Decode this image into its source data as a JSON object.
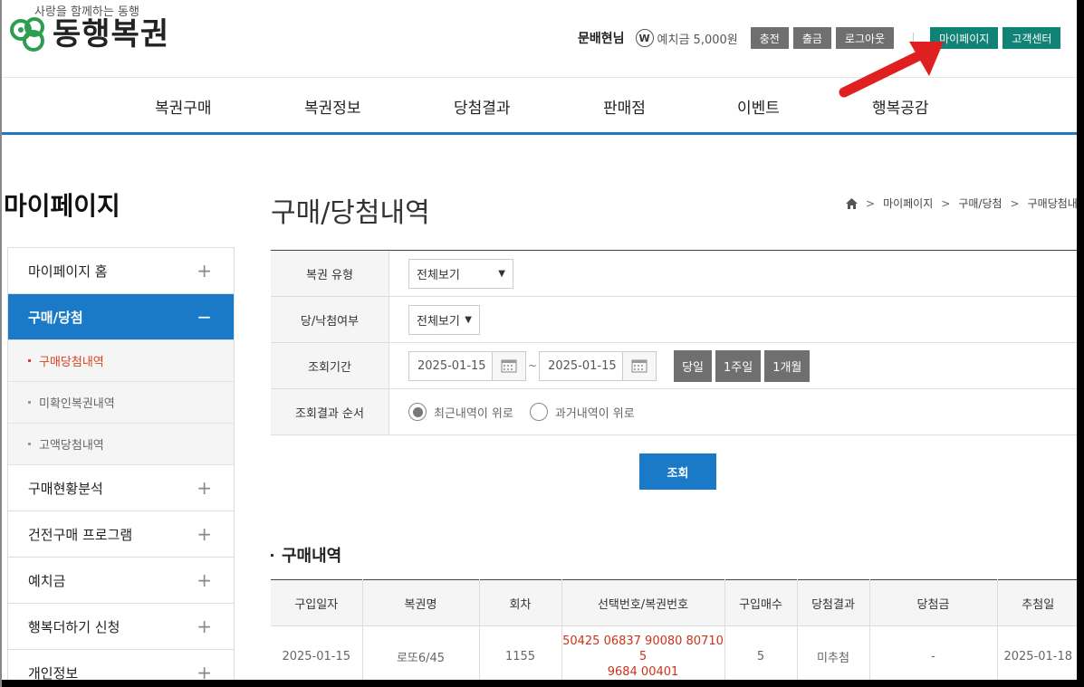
{
  "header": {
    "slogan": "사랑을 함께하는 동행",
    "brand": "동행복권",
    "user": "문배현님",
    "won_symbol": "W",
    "deposit_label": "예치금 5,000원",
    "buttons": {
      "charge": "충전",
      "withdraw": "출금",
      "logout": "로그아웃",
      "mypage": "마이페이지",
      "support": "고객센터"
    }
  },
  "gnb": [
    "복권구매",
    "복권정보",
    "당첨결과",
    "판매점",
    "이벤트",
    "행복공감"
  ],
  "sidebar": {
    "title": "마이페이지",
    "items": [
      {
        "label": "마이페이지 홈",
        "mark": "+"
      },
      {
        "label": "구매/당첨",
        "mark": "−"
      },
      {
        "label": "구매현황분석",
        "mark": "+"
      },
      {
        "label": "건전구매 프로그램",
        "mark": "+"
      },
      {
        "label": "예치금",
        "mark": "+"
      },
      {
        "label": "행복더하기 신청",
        "mark": "+"
      },
      {
        "label": "개인정보",
        "mark": "+"
      }
    ],
    "sub": [
      "구매당첨내역",
      "미확인복권내역",
      "고액당첨내역"
    ]
  },
  "page": {
    "title": "구매/당첨내역",
    "breadcrumb": [
      "마이페이지",
      "구매/당첨",
      "구매당첨내"
    ]
  },
  "filter": {
    "type_label": "복권 유형",
    "type_value": "전체보기",
    "win_label": "당/낙첨여부",
    "win_value": "전체보기",
    "period_label": "조회기간",
    "date_from": "2025-01-15",
    "date_to": "2025-01-15",
    "tilde": "~",
    "quick": [
      "당일",
      "1주일",
      "1개월"
    ],
    "order_label": "조회결과 순서",
    "order_options": [
      "최근내역이 위로",
      "과거내역이 위로"
    ],
    "search": "조회"
  },
  "purchases": {
    "title": "구매내역",
    "headers": [
      "구입일자",
      "복권명",
      "회차",
      "선택번호/복권번호",
      "구입매수",
      "당첨결과",
      "당첨금",
      "추첨일"
    ],
    "row": {
      "date": "2025-01-15",
      "name": "로또6/45",
      "round": "1155",
      "numbers_1": "50425 06837 90080 80710 5",
      "numbers_2": "9684 00401",
      "count": "5",
      "result": "미추첨",
      "prize": "-",
      "draw_date": "2025-01-18"
    }
  }
}
